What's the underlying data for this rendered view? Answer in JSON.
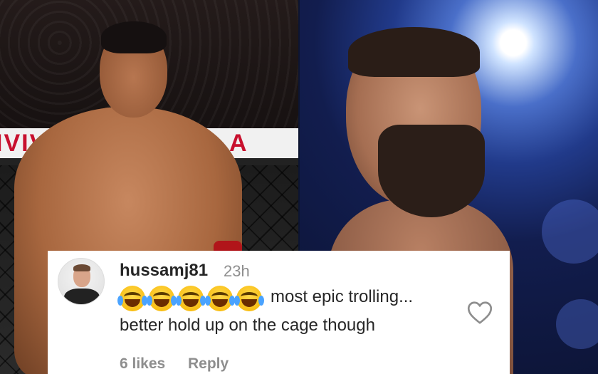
{
  "left_photo": {
    "cage_sign_left": "IVIV",
    "cage_sign_right": "A"
  },
  "comment": {
    "username": "hussamj81",
    "time": "23h",
    "emoji": [
      "tears-of-joy-emoji",
      "tears-of-joy-emoji",
      "tears-of-joy-emoji",
      "tears-of-joy-emoji",
      "tears-of-joy-emoji"
    ],
    "text_line1": "most epic trolling...",
    "text_line2": "better hold up on the cage though",
    "likes": "6 likes",
    "reply_label": "Reply",
    "heart_icon": "heart-outline-icon"
  },
  "colors": {
    "text_primary": "#262626",
    "text_secondary": "#8e8e8e",
    "cage_sign_red": "#c8102e"
  }
}
